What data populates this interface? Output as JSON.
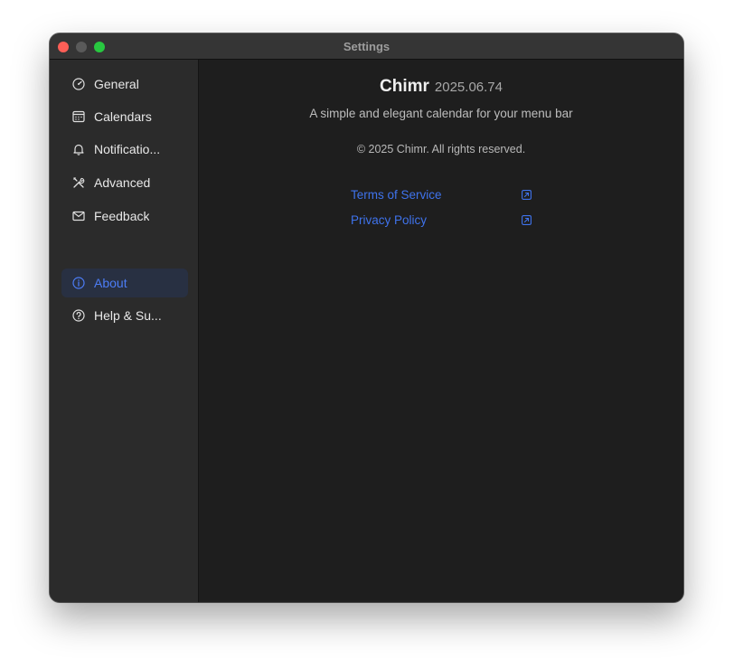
{
  "window": {
    "title": "Settings"
  },
  "sidebar": {
    "items": [
      {
        "label": "General",
        "icon": "speedometer-icon"
      },
      {
        "label": "Calendars",
        "icon": "calendar-icon"
      },
      {
        "label": "Notificatio...",
        "icon": "bell-icon"
      },
      {
        "label": "Advanced",
        "icon": "tools-icon"
      },
      {
        "label": "Feedback",
        "icon": "envelope-icon"
      },
      {
        "label": "About",
        "icon": "info-icon",
        "selected": true
      },
      {
        "label": "Help & Su...",
        "icon": "question-icon"
      }
    ]
  },
  "about": {
    "app_name": "Chimr",
    "version": "2025.06.74",
    "tagline": "A simple and elegant calendar for your menu bar",
    "copyright": "© 2025 Chimr. All rights reserved.",
    "links": [
      {
        "label": "Terms of Service",
        "icon": "external-link-icon"
      },
      {
        "label": "Privacy Policy",
        "icon": "external-link-icon"
      }
    ]
  },
  "colors": {
    "accent": "#3f73ec",
    "selected_bg": "#283042",
    "sidebar_bg": "#2b2b2b",
    "content_bg": "#1e1e1e",
    "close": "#fe5f57",
    "maximize": "#28c840"
  }
}
